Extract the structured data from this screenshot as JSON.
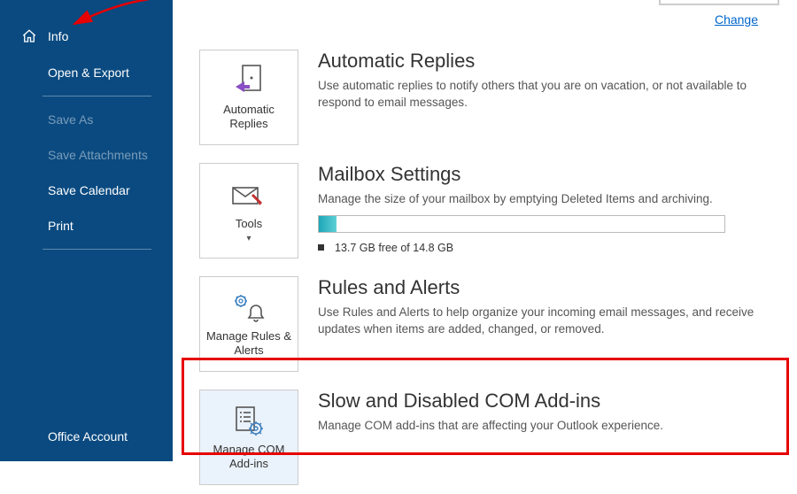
{
  "sidebar": {
    "info_label": "Info",
    "open_export_label": "Open & Export",
    "save_as_label": "Save As",
    "save_attachments_label": "Save Attachments",
    "save_calendar_label": "Save Calendar",
    "print_label": "Print",
    "office_account_label": "Office Account"
  },
  "top": {
    "change_label": "Change"
  },
  "sections": {
    "auto_replies": {
      "tile_label": "Automatic Replies",
      "title": "Automatic Replies",
      "desc": "Use automatic replies to notify others that you are on vacation, or not available to respond to email messages."
    },
    "mailbox": {
      "tile_label": "Tools",
      "title": "Mailbox Settings",
      "desc": "Manage the size of your mailbox by emptying Deleted Items and archiving.",
      "free_text": "13.7 GB free of 14.8 GB"
    },
    "rules": {
      "tile_label": "Manage Rules & Alerts",
      "title": "Rules and Alerts",
      "desc": "Use Rules and Alerts to help organize your incoming email messages, and receive updates when items are added, changed, or removed."
    },
    "addins": {
      "tile_label": "Manage COM Add-ins",
      "title": "Slow and Disabled COM Add-ins",
      "desc": "Manage COM add-ins that are affecting your Outlook experience."
    }
  }
}
